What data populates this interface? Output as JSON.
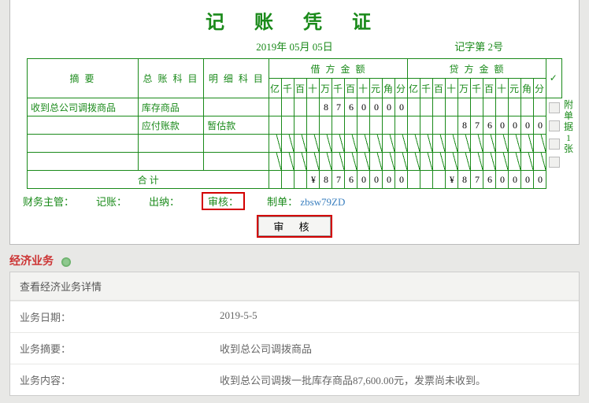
{
  "voucher": {
    "title": "记 账 凭 证",
    "date": "2019年 05月 05日",
    "number_label": "记字第 2号",
    "columns": {
      "summary": "摘  要",
      "general_account": "总 账 科 目",
      "sub_account": "明 细 科 目",
      "debit": "借 方 金 额",
      "credit": "贷 方 金 额",
      "check": "✓",
      "digits": [
        "亿",
        "千",
        "百",
        "十",
        "万",
        "千",
        "百",
        "十",
        "元",
        "角",
        "分"
      ]
    },
    "rows": [
      {
        "summary": "收到总公司调拨商品",
        "general": "库存商品",
        "sub": "",
        "debit": [
          "",
          "",
          "",
          "",
          "8",
          "7",
          "6",
          "0",
          "0",
          "0",
          "0"
        ],
        "credit": [
          "",
          "",
          "",
          "",
          "",
          "",
          "",
          "",
          "",
          "",
          ""
        ]
      },
      {
        "summary": "",
        "general": "应付账款",
        "sub": "暂估款",
        "debit": [
          "",
          "",
          "",
          "",
          "",
          "",
          "",
          "",
          "",
          "",
          ""
        ],
        "credit": [
          "",
          "",
          "",
          "",
          "8",
          "7",
          "6",
          "0",
          "0",
          "0",
          "0"
        ]
      },
      {
        "summary": "",
        "general": "",
        "sub": "",
        "debit": [
          "",
          "",
          "",
          "",
          "",
          "",
          "",
          "",
          "",
          "",
          ""
        ],
        "credit": [
          "",
          "",
          "",
          "",
          "",
          "",
          "",
          "",
          "",
          "",
          ""
        ]
      },
      {
        "summary": "",
        "general": "",
        "sub": "",
        "debit": [
          "",
          "",
          "",
          "",
          "",
          "",
          "",
          "",
          "",
          "",
          ""
        ],
        "credit": [
          "",
          "",
          "",
          "",
          "",
          "",
          "",
          "",
          "",
          "",
          ""
        ]
      }
    ],
    "total": {
      "label": "合              计",
      "debit": [
        "",
        "",
        "",
        "¥",
        "8",
        "7",
        "6",
        "0",
        "0",
        "0",
        "0"
      ],
      "credit": [
        "",
        "",
        "",
        "¥",
        "8",
        "7",
        "6",
        "0",
        "0",
        "0",
        "0"
      ]
    },
    "attachments_label": "附单据 1 张",
    "signoff": {
      "finance_manager": "财务主管：",
      "bookkeeper": "记账：",
      "cashier": "出纳：",
      "auditor": "审核：",
      "maker_label": "制单：",
      "maker_value": "zbsw79ZD"
    },
    "audit_button": "审 核"
  },
  "business": {
    "section_title": "经济业务",
    "panel_title": "查看经济业务详情",
    "rows": [
      {
        "k": "业务日期：",
        "v": "2019-5-5"
      },
      {
        "k": "业务摘要：",
        "v": "收到总公司调拨商品"
      },
      {
        "k": "业务内容：",
        "v": "收到总公司调拨一批库存商品87,600.00元，发票尚未收到。"
      }
    ]
  }
}
